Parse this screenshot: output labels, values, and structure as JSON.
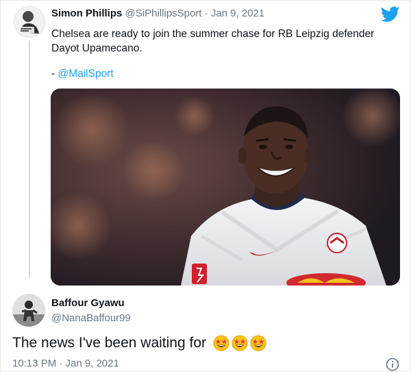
{
  "quoted_tweet": {
    "author_name": "Simon Phillips",
    "author_handle": "@SiPhillipsSport",
    "separator": " · ",
    "date": "Jan 9, 2021",
    "text": "Chelsea are ready to join the summer chase for RB Leipzig defender Dayot Upamecano.",
    "credit_prefix": "- ",
    "credit_mention": "@MailSport",
    "icon": "twitter-bird-icon",
    "link_color": "#1da1f2"
  },
  "main_tweet": {
    "author_name": "Baffour Gyawu",
    "author_handle": "@NanaBaffour99",
    "text": "The news I've been waiting for",
    "emojis": [
      "star-struck-emoji",
      "star-struck-emoji",
      "star-struck-emoji"
    ],
    "timestamp": "10:13 PM · Jan 9, 2021",
    "icon": "info-icon"
  }
}
